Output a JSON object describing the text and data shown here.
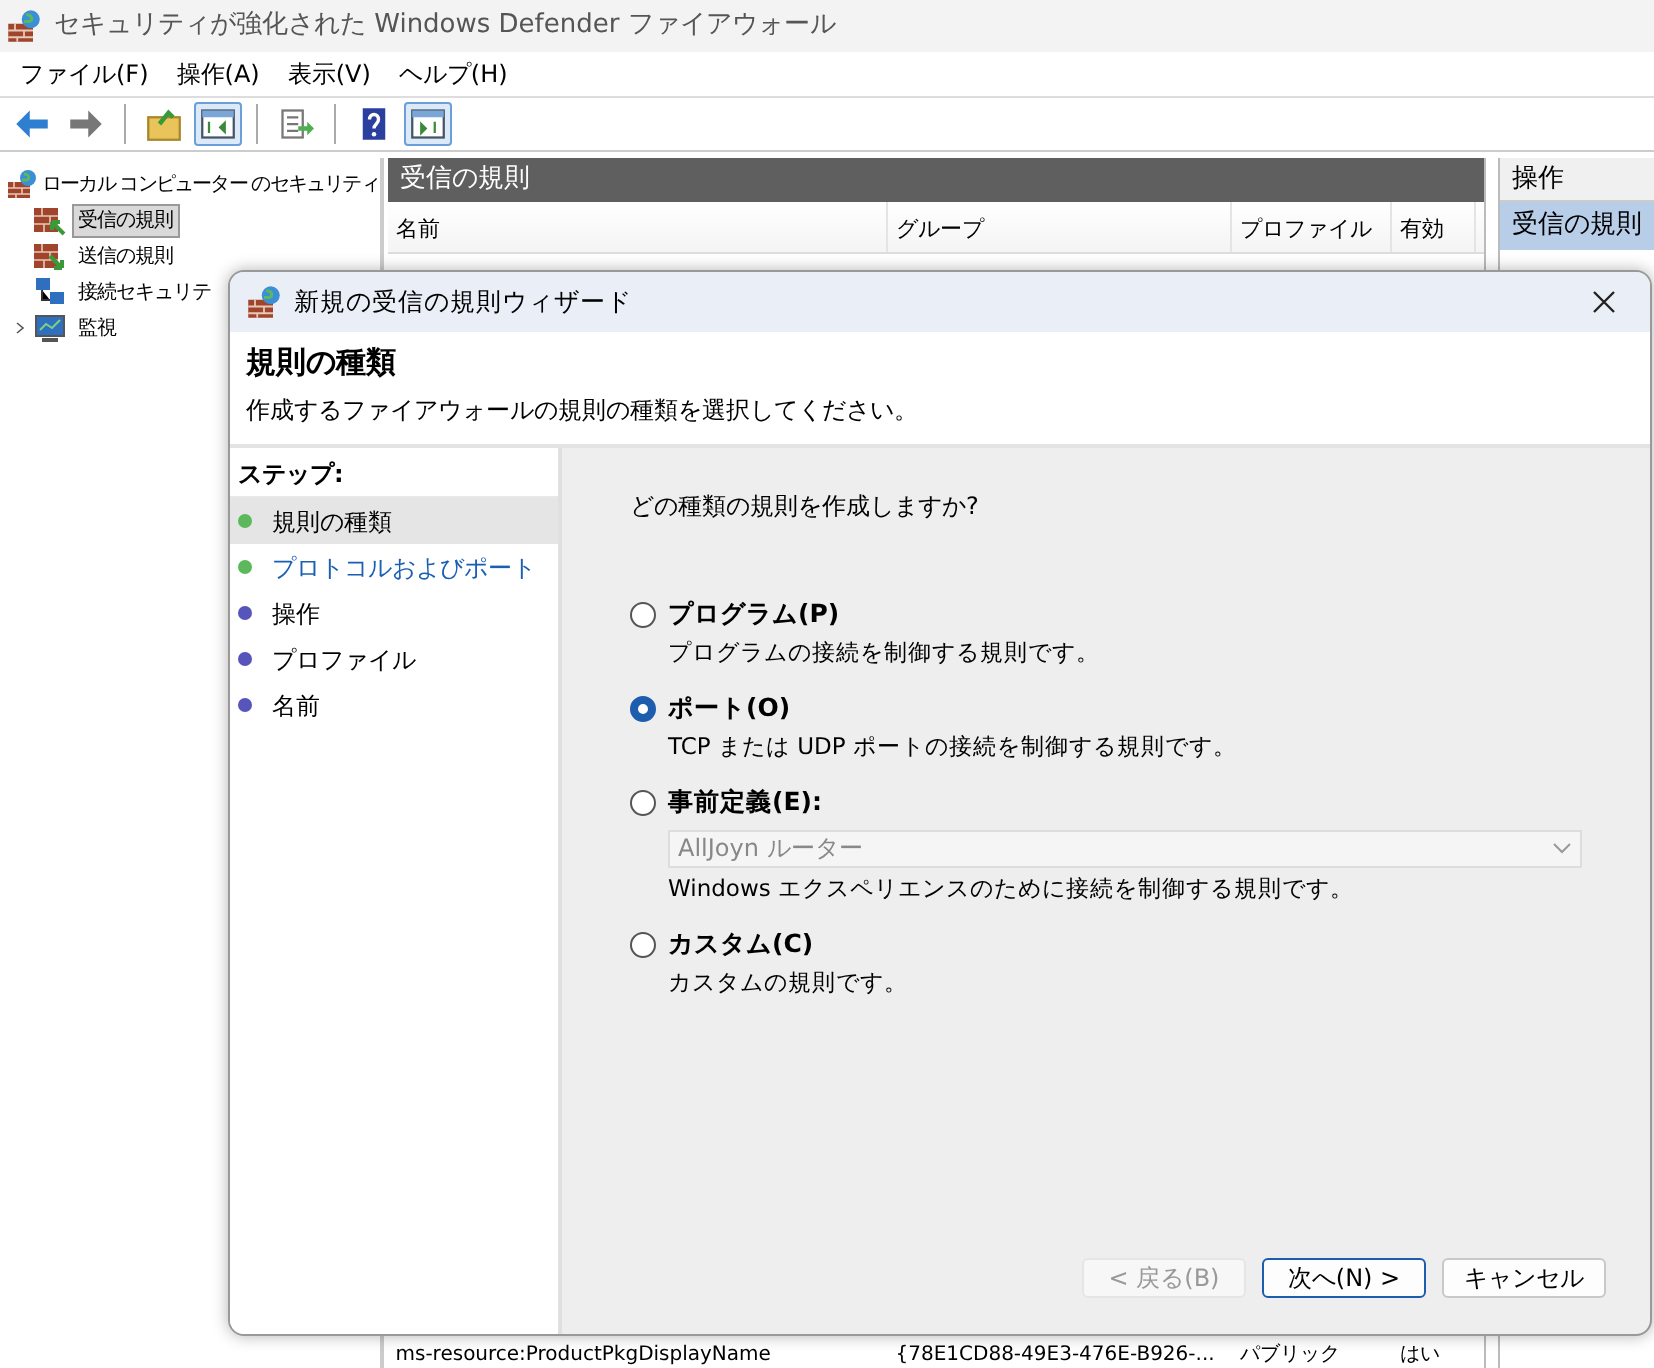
{
  "window": {
    "title": "セキュリティが強化された Windows Defender ファイアウォール"
  },
  "menu": [
    "ファイル(F)",
    "操作(A)",
    "表示(V)",
    "ヘルプ(H)"
  ],
  "toolbar": [
    {
      "kind": "back",
      "pressed": false
    },
    {
      "kind": "forward",
      "pressed": false
    },
    {
      "kind": "sep"
    },
    {
      "kind": "up",
      "pressed": false
    },
    {
      "kind": "tree",
      "pressed": true
    },
    {
      "kind": "sep"
    },
    {
      "kind": "export",
      "pressed": false
    },
    {
      "kind": "sep"
    },
    {
      "kind": "help",
      "pressed": false
    },
    {
      "kind": "pane",
      "pressed": true
    }
  ],
  "tree": {
    "label": "ローカル コンピューター のセキュリティ",
    "children": [
      {
        "label": "受信の規則",
        "kind": "in",
        "selected": true,
        "expandable": false
      },
      {
        "label": "送信の規則",
        "kind": "out",
        "selected": false,
        "expandable": false
      },
      {
        "label": "接続セキュリテ",
        "kind": "conn",
        "selected": false,
        "expandable": false
      },
      {
        "label": "監視",
        "kind": "monitor",
        "selected": false,
        "expandable": true
      }
    ]
  },
  "rules_panel": {
    "title": "受信の規則",
    "columns": [
      "名前",
      "グループ",
      "プロファイル",
      "有効"
    ],
    "rows": [
      {
        "name": "ms-resource:ProductPkgDisplayName",
        "group": "{78E1CD88-49E3-476E-B926-...",
        "profile": "パブリック",
        "enabled": "はい"
      }
    ]
  },
  "actions_panel": {
    "title": "操作",
    "items": [
      {
        "label": "受信の規則",
        "selected": true
      }
    ]
  },
  "wizard": {
    "title": "新規の受信の規則ウィザード",
    "heading": "規則の種類",
    "subtitle": "作成するファイアウォールの規則の種類を選択してください。",
    "steps_title": "ステップ:",
    "steps": [
      {
        "label": "規則の種類",
        "selected": true,
        "link": false,
        "color": "#5cb85c"
      },
      {
        "label": "プロトコルおよびポート",
        "selected": false,
        "link": true,
        "color": "#5cb85c"
      },
      {
        "label": "操作",
        "selected": false,
        "link": false,
        "color": "#5555bb"
      },
      {
        "label": "プロファイル",
        "selected": false,
        "link": false,
        "color": "#5555bb"
      },
      {
        "label": "名前",
        "selected": false,
        "link": false,
        "color": "#5555bb"
      }
    ],
    "question": "どの種類の規則を作成しますか?",
    "options": [
      {
        "label": "プログラム(P)",
        "description": "プログラムの接続を制御する規則です。",
        "selected": false
      },
      {
        "label": "ポート(O)",
        "description": "TCP または UDP ポートの接続を制御する規則です。",
        "selected": true
      },
      {
        "label": "事前定義(E):",
        "description": "Windows エクスペリエンスのために接続を制御する規則です。",
        "selected": false,
        "dropdown": {
          "value": "AllJoyn ルーター",
          "disabled": true
        }
      },
      {
        "label": "カスタム(C)",
        "description": "カスタムの規則です。",
        "selected": false
      }
    ],
    "buttons": [
      {
        "label": "< 戻る(B)",
        "disabled": true,
        "default": false
      },
      {
        "label": "次へ(N) >",
        "disabled": false,
        "default": true
      },
      {
        "label": "キャンセル",
        "disabled": false,
        "default": false
      }
    ]
  }
}
